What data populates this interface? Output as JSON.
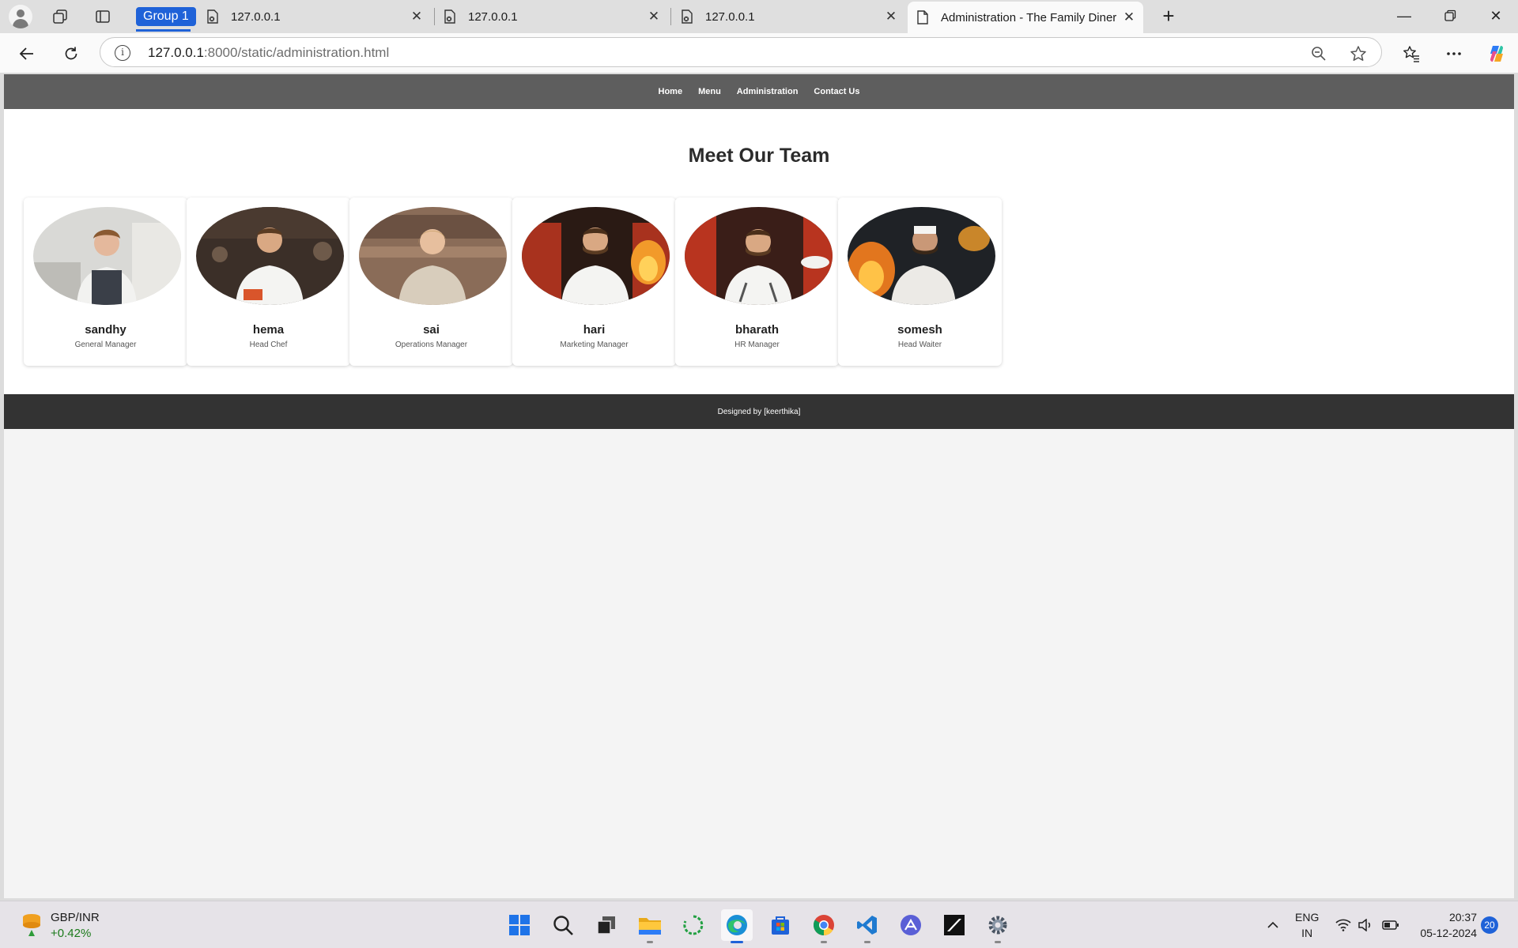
{
  "browser": {
    "group_label": "Group 1",
    "tabs": [
      {
        "title": "127.0.0.1"
      },
      {
        "title": "127.0.0.1"
      },
      {
        "title": "127.0.0.1"
      },
      {
        "title": "Administration - The Family Diner"
      }
    ],
    "url_host": "127.0.0.1",
    "url_rest": ":8000/static/administration.html"
  },
  "site": {
    "nav": [
      "Home",
      "Menu",
      "Administration",
      "Contact Us"
    ],
    "heading": "Meet Our Team",
    "team": [
      {
        "name": "sandhy",
        "role": "General Manager"
      },
      {
        "name": "hema",
        "role": "Head Chef"
      },
      {
        "name": "sai",
        "role": "Operations Manager"
      },
      {
        "name": "hari",
        "role": "Marketing Manager"
      },
      {
        "name": "bharath",
        "role": "HR Manager"
      },
      {
        "name": "somesh",
        "role": "Head Waiter"
      }
    ],
    "footer_text": "Designed by",
    "footer_brand": "[keerthika]"
  },
  "taskbar": {
    "ticker_name": "GBP/INR",
    "ticker_change": "+0.42%",
    "lang_top": "ENG",
    "lang_bottom": "IN",
    "time": "20:37",
    "date": "05-12-2024",
    "notification_count": "20"
  }
}
